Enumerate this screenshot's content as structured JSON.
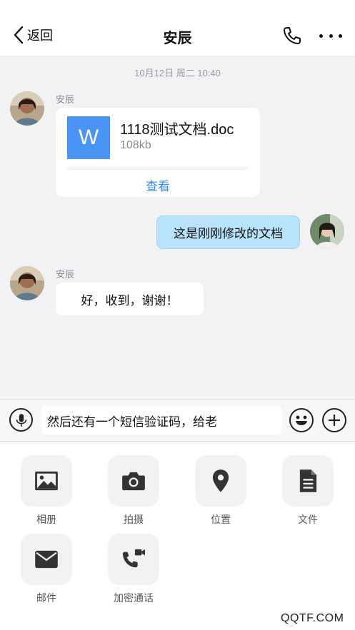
{
  "header": {
    "back_label": "返回",
    "title": "安辰",
    "call_icon": "phone-icon",
    "more_icon": "more-dots-icon"
  },
  "timestamp": "10月12日 周二 10:40",
  "messages": [
    {
      "sender": "安辰",
      "type": "file",
      "file_icon_letter": "W",
      "file_name": "1118测试文档.doc",
      "file_size": "108kb",
      "action_label": "查看"
    },
    {
      "sender": "me",
      "type": "text",
      "text": "这是刚刚修改的文档"
    },
    {
      "sender": "安辰",
      "type": "text",
      "text": "好，收到，谢谢！"
    }
  ],
  "input_bar": {
    "value": "然后还有一个短信验证码，给老",
    "mic_icon": "microphone-icon",
    "emoji_icon": "smiley-icon",
    "add_icon": "plus-icon"
  },
  "tools": [
    {
      "label": "相册",
      "icon": "image-icon"
    },
    {
      "label": "拍摄",
      "icon": "camera-icon"
    },
    {
      "label": "位置",
      "icon": "location-pin-icon"
    },
    {
      "label": "文件",
      "icon": "document-icon"
    },
    {
      "label": "邮件",
      "icon": "mail-icon"
    },
    {
      "label": "加密通话",
      "icon": "video-call-icon"
    }
  ],
  "watermark": "QQTF.COM",
  "colors": {
    "accent": "#3a8ee6",
    "outgoing_bubble": "#b9e2fb",
    "word_icon": "#4a94f5",
    "background": "#f2f2f5"
  }
}
